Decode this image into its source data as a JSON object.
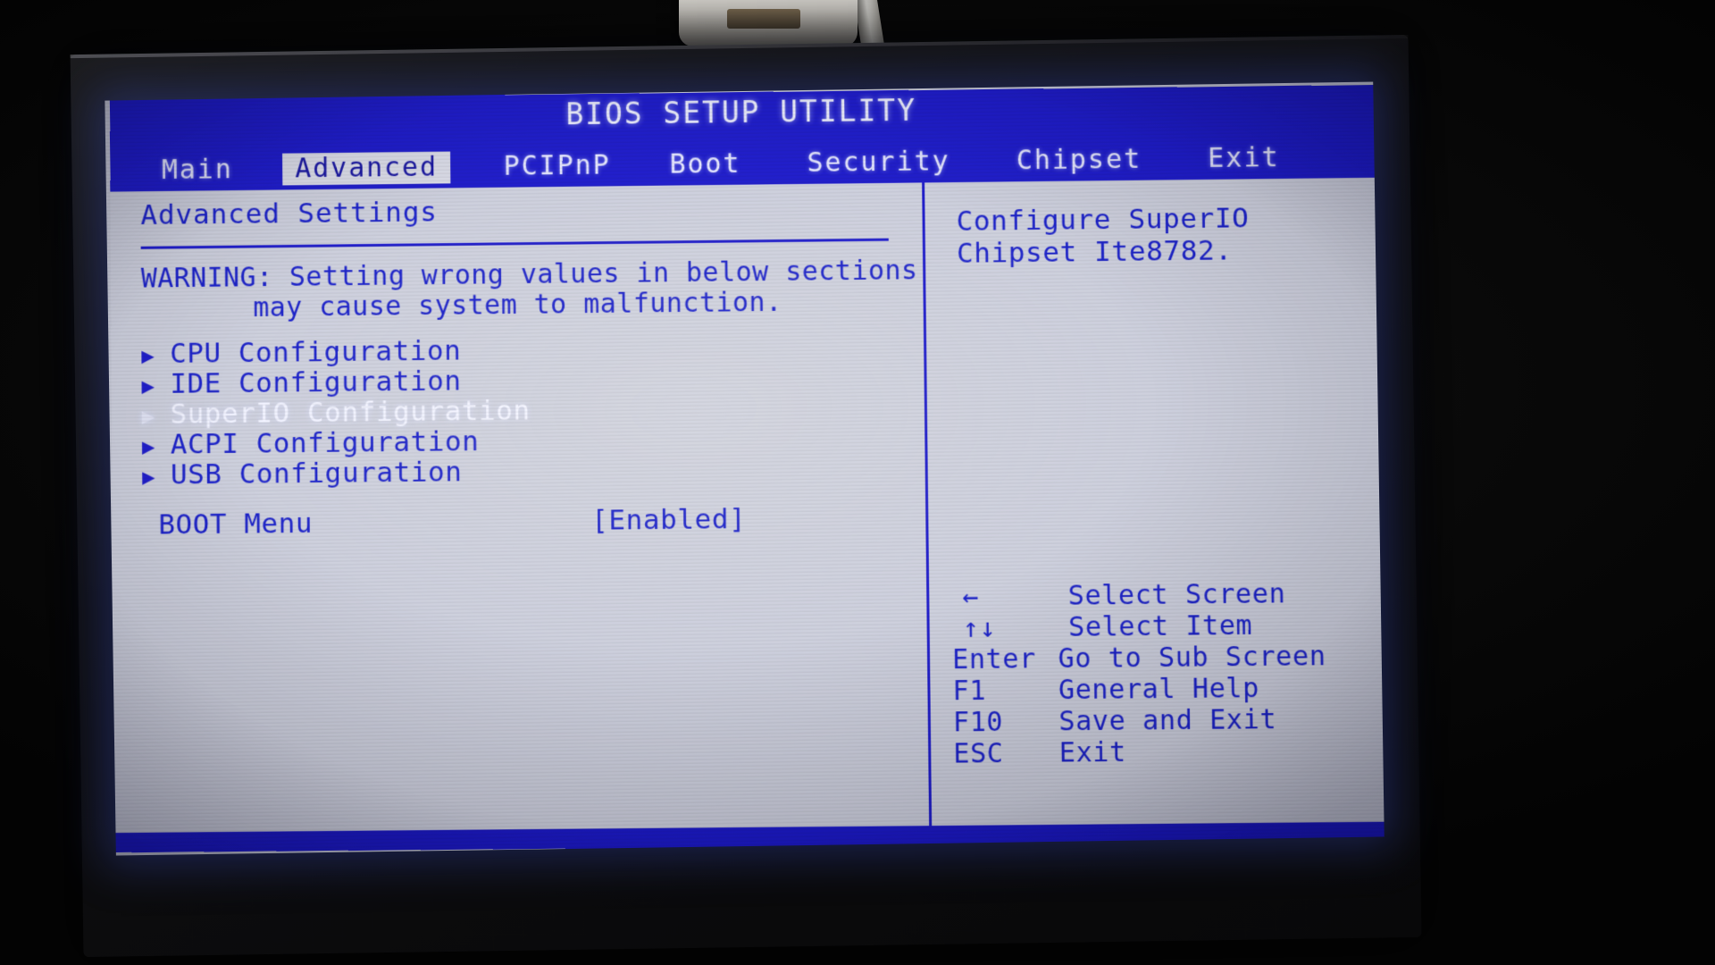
{
  "screen": {
    "title": "BIOS SETUP UTILITY",
    "menu": [
      {
        "label": "Main",
        "selected": false
      },
      {
        "label": "Advanced",
        "selected": true
      },
      {
        "label": "PCIPnP",
        "selected": false
      },
      {
        "label": "Boot",
        "selected": false
      },
      {
        "label": "Security",
        "selected": false
      },
      {
        "label": "Chipset",
        "selected": false
      },
      {
        "label": "Exit",
        "selected": false
      }
    ],
    "section_title": "Advanced Settings",
    "warning": {
      "line1": "WARNING: Setting wrong values in below sections",
      "line2": "may cause system to malfunction."
    },
    "items": [
      {
        "label": "CPU Configuration",
        "selected": false
      },
      {
        "label": "IDE Configuration",
        "selected": false
      },
      {
        "label": "SuperIO Configuration",
        "selected": true
      },
      {
        "label": "ACPI Configuration",
        "selected": false
      },
      {
        "label": "USB Configuration",
        "selected": false
      }
    ],
    "option": {
      "label": "BOOT Menu",
      "value": "[Enabled]"
    },
    "help": {
      "line1": "Configure SuperIO",
      "line2": "Chipset Ite8782."
    },
    "keys": [
      {
        "key": "←",
        "desc": "Select Screen"
      },
      {
        "key": "↑↓",
        "desc": "Select Item"
      },
      {
        "key": "Enter",
        "desc": "Go to Sub Screen"
      },
      {
        "key": "F1",
        "desc": "General Help"
      },
      {
        "key": "F10",
        "desc": "Save and Exit"
      },
      {
        "key": "ESC",
        "desc": "Exit"
      }
    ],
    "colors": {
      "bios_blue": "#1a17c9",
      "screen_bg": "#cfd1dc",
      "highlight_text": "#f4f5ff"
    }
  }
}
